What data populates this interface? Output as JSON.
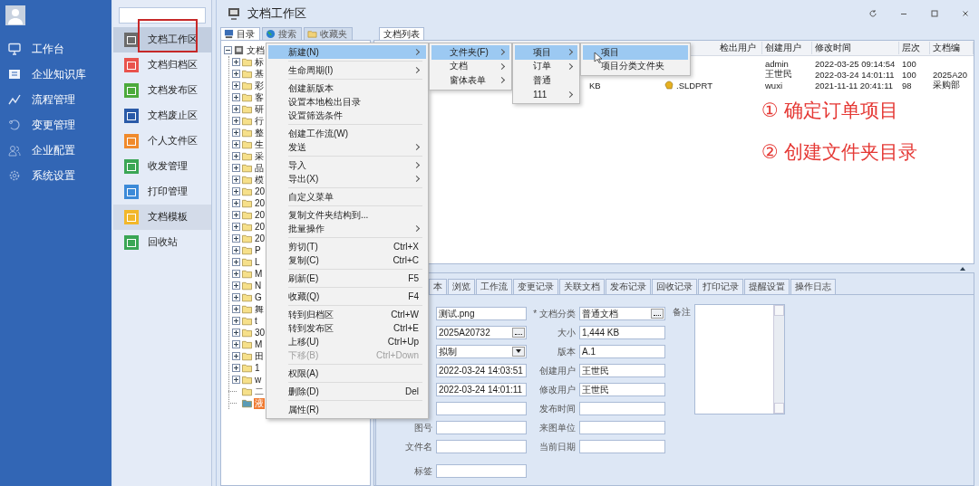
{
  "nav": {
    "items": [
      {
        "label": "工作台"
      },
      {
        "label": "企业知识库"
      },
      {
        "label": "流程管理"
      },
      {
        "label": "变更管理"
      },
      {
        "label": "企业配置"
      },
      {
        "label": "系统设置"
      }
    ]
  },
  "module_list": {
    "items": [
      {
        "label": "文档工作区",
        "color": "#6b6b6b",
        "selected": true,
        "hovered": false,
        "outlined": true
      },
      {
        "label": "文档归档区",
        "color": "#e9534d",
        "selected": false,
        "hovered": false,
        "outlined": false
      },
      {
        "label": "文档发布区",
        "color": "#4caa3c",
        "selected": false,
        "hovered": false,
        "outlined": false
      },
      {
        "label": "文档废止区",
        "color": "#2a5aa8",
        "selected": false,
        "hovered": false,
        "outlined": false
      },
      {
        "label": "个人文件区",
        "color": "#f08a2c",
        "selected": false,
        "hovered": false,
        "outlined": false
      },
      {
        "label": "收发管理",
        "color": "#3aa655",
        "selected": false,
        "hovered": false,
        "outlined": false
      },
      {
        "label": "打印管理",
        "color": "#3c8ad8",
        "selected": false,
        "hovered": false,
        "outlined": false
      },
      {
        "label": "文档模板",
        "color": "#f2b72a",
        "selected": false,
        "hovered": true,
        "outlined": false
      },
      {
        "label": "回收站",
        "color": "#3aa655",
        "selected": false,
        "hovered": false,
        "outlined": false
      }
    ]
  },
  "window": {
    "title": "文档工作区"
  },
  "tree_tabs": [
    {
      "label": "目录",
      "selected": true
    },
    {
      "label": "搜索",
      "selected": false
    },
    {
      "label": "收藏夹",
      "selected": false
    }
  ],
  "tree": {
    "label": "文档",
    "expanded": true,
    "children": [
      {
        "label": "标",
        "has_children": true,
        "selected": false
      },
      {
        "label": "基",
        "has_children": true,
        "selected": false
      },
      {
        "label": "彩",
        "has_children": true,
        "selected": false
      },
      {
        "label": "客",
        "has_children": true,
        "selected": false
      },
      {
        "label": "研",
        "has_children": true,
        "selected": false
      },
      {
        "label": "行",
        "has_children": true,
        "selected": false
      },
      {
        "label": "整",
        "has_children": true,
        "selected": false
      },
      {
        "label": "生",
        "has_children": true,
        "selected": false
      },
      {
        "label": "采",
        "has_children": true,
        "selected": false
      },
      {
        "label": "品",
        "has_children": true,
        "selected": false
      },
      {
        "label": "模",
        "has_children": true,
        "selected": false
      },
      {
        "label": "20",
        "has_children": true,
        "selected": false
      },
      {
        "label": "20",
        "has_children": true,
        "selected": false
      },
      {
        "label": "20",
        "has_children": true,
        "selected": false
      },
      {
        "label": "20",
        "has_children": true,
        "selected": false
      },
      {
        "label": "20",
        "has_children": true,
        "selected": false
      },
      {
        "label": "P",
        "has_children": true,
        "selected": false
      },
      {
        "label": "L",
        "has_children": true,
        "selected": false
      },
      {
        "label": "M",
        "has_children": true,
        "selected": false
      },
      {
        "label": "N",
        "has_children": true,
        "selected": false
      },
      {
        "label": "G",
        "has_children": true,
        "selected": false
      },
      {
        "label": "舞",
        "has_children": true,
        "selected": false
      },
      {
        "label": "t",
        "has_children": true,
        "selected": false
      },
      {
        "label": "30",
        "has_children": true,
        "selected": false
      },
      {
        "label": "M",
        "has_children": true,
        "selected": false
      },
      {
        "label": "田",
        "has_children": true,
        "selected": false
      },
      {
        "label": "1",
        "has_children": true,
        "selected": false
      },
      {
        "label": "w",
        "has_children": true,
        "selected": false
      },
      {
        "label": "二",
        "has_children": false,
        "selected": false
      },
      {
        "label": "液",
        "has_children": false,
        "selected": true
      }
    ]
  },
  "list_tab": {
    "label": "文档列表"
  },
  "table": {
    "columns": [
      {
        "label": "检出用户"
      },
      {
        "label": "创建用户"
      },
      {
        "label": "修改时间"
      },
      {
        "label": "层次"
      },
      {
        "label": "文档编"
      }
    ],
    "rows": [
      {
        "created_by": "admin",
        "modified": "2022-03-25 09:14:54",
        "level": "100"
      },
      {
        "created_by": "王世民",
        "modified": "2022-03-24 14:01:11",
        "level": "100",
        "code": "2025A20"
      },
      {
        "column_2": "KB",
        "column_3": ".SLDPRT",
        "file_icon": true,
        "created_by": "wuxi",
        "modified": "2021-11-11 20:41:11",
        "level": "98",
        "code": "采购部"
      }
    ]
  },
  "annotations": [
    "① 确定订单项目",
    "② 创建文件夹目录"
  ],
  "detail_tabs": [
    "本",
    "浏览",
    "工作流",
    "变更记录",
    "关联文档",
    "发布记录",
    "回收记录",
    "打印记录",
    "提醒设置",
    "操作日志"
  ],
  "form": {
    "left": [
      {
        "value": "测试.png",
        "kind": "text"
      },
      {
        "value": "2025A20732",
        "kind": "browse"
      },
      {
        "value": "拟制",
        "kind": "select"
      },
      {
        "value": "2022-03-24 14:03:51",
        "kind": "text"
      },
      {
        "value": "2022-03-24 14:01:11",
        "kind": "text"
      },
      {
        "kind": "text"
      },
      {
        "label": "图号",
        "kind": "text"
      },
      {
        "label": "文件名",
        "kind": "text"
      },
      {
        "label": "标签",
        "kind": "text"
      }
    ],
    "middle": [
      {
        "label": "* 文档分类",
        "value": "普通文档",
        "kind": "browse"
      },
      {
        "label": "大小",
        "value": "1,444 KB",
        "kind": "text"
      },
      {
        "label": "版本",
        "value": "A.1",
        "kind": "text"
      },
      {
        "label": "创建用户",
        "value": "王世民",
        "kind": "text"
      },
      {
        "label": "修改用户",
        "value": "王世民",
        "kind": "text"
      },
      {
        "label": "发布时间",
        "kind": "text"
      },
      {
        "label": "来图单位",
        "kind": "text"
      },
      {
        "label": "当前日期",
        "kind": "text"
      }
    ],
    "remark": {
      "label": "备注"
    }
  },
  "context_menu": {
    "groups": [
      [
        {
          "label": "新建(N)",
          "has_submenu": true,
          "highlighted": true,
          "disabled": false
        }
      ],
      [
        {
          "label": "生命周期(I)",
          "has_submenu": true,
          "highlighted": false,
          "disabled": false
        }
      ],
      [
        {
          "label": "创建新版本",
          "has_submenu": false,
          "highlighted": false,
          "disabled": false
        },
        {
          "label": "设置本地检出目录",
          "has_submenu": false,
          "highlighted": false,
          "disabled": false
        },
        {
          "label": "设置筛选条件",
          "has_submenu": false,
          "highlighted": false,
          "disabled": false
        }
      ],
      [
        {
          "label": "创建工作流(W)",
          "has_submenu": false,
          "highlighted": false,
          "disabled": false
        },
        {
          "label": "发送",
          "has_submenu": true,
          "highlighted": false,
          "disabled": false
        }
      ],
      [
        {
          "label": "导入",
          "has_submenu": true,
          "highlighted": false,
          "disabled": false
        },
        {
          "label": "导出(X)",
          "has_submenu": true,
          "highlighted": false,
          "disabled": false
        }
      ],
      [
        {
          "label": "自定义菜单",
          "has_submenu": false,
          "highlighted": false,
          "disabled": false
        }
      ],
      [
        {
          "label": "复制文件夹结构到...",
          "has_submenu": false,
          "highlighted": false,
          "disabled": false
        },
        {
          "label": "批量操作",
          "has_submenu": true,
          "highlighted": false,
          "disabled": false
        }
      ],
      [
        {
          "label": "剪切(T)",
          "shortcut": "Ctrl+X",
          "has_submenu": false,
          "highlighted": false,
          "disabled": false
        },
        {
          "label": "复制(C)",
          "shortcut": "Ctrl+C",
          "has_submenu": false,
          "highlighted": false,
          "disabled": false
        }
      ],
      [
        {
          "label": "刷新(E)",
          "shortcut": "F5",
          "has_submenu": false,
          "highlighted": false,
          "disabled": false
        }
      ],
      [
        {
          "label": "收藏(Q)",
          "shortcut": "F4",
          "has_submenu": false,
          "highlighted": false,
          "disabled": false
        }
      ],
      [
        {
          "label": "转到归档区",
          "shortcut": "Ctrl+W",
          "has_submenu": false,
          "highlighted": false,
          "disabled": false
        },
        {
          "label": "转到发布区",
          "shortcut": "Ctrl+E",
          "has_submenu": false,
          "highlighted": false,
          "disabled": false
        },
        {
          "label": "上移(U)",
          "shortcut": "Ctrl+Up",
          "has_submenu": false,
          "highlighted": false,
          "disabled": false
        },
        {
          "label": "下移(B)",
          "shortcut": "Ctrl+Down",
          "has_submenu": false,
          "highlighted": false,
          "disabled": true
        }
      ],
      [
        {
          "label": "权限(A)",
          "has_submenu": false,
          "highlighted": false,
          "disabled": false
        }
      ],
      [
        {
          "label": "删除(D)",
          "shortcut": "Del",
          "has_submenu": false,
          "highlighted": false,
          "disabled": false
        }
      ],
      [
        {
          "label": "属性(R)",
          "has_submenu": false,
          "highlighted": false,
          "disabled": false
        }
      ]
    ]
  },
  "submenus": [
    {
      "items": [
        {
          "label": "文件夹(F)",
          "has_submenu": true,
          "highlighted": true
        },
        {
          "label": "文档",
          "has_submenu": true,
          "highlighted": false
        },
        {
          "label": "窗体表单",
          "has_submenu": true,
          "highlighted": false
        }
      ]
    },
    {
      "items": [
        {
          "label": "项目",
          "has_submenu": true,
          "highlighted": true
        },
        {
          "label": "订单",
          "has_submenu": true,
          "highlighted": false
        },
        {
          "label": "普通",
          "has_submenu": false,
          "highlighted": false
        },
        {
          "label": "111",
          "has_submenu": true,
          "highlighted": false
        }
      ]
    },
    {
      "items": [
        {
          "label": "项目",
          "has_submenu": false,
          "highlighted": true
        },
        {
          "label": "项目分类文件夹",
          "has_submenu": false,
          "highlighted": false
        }
      ]
    }
  ]
}
